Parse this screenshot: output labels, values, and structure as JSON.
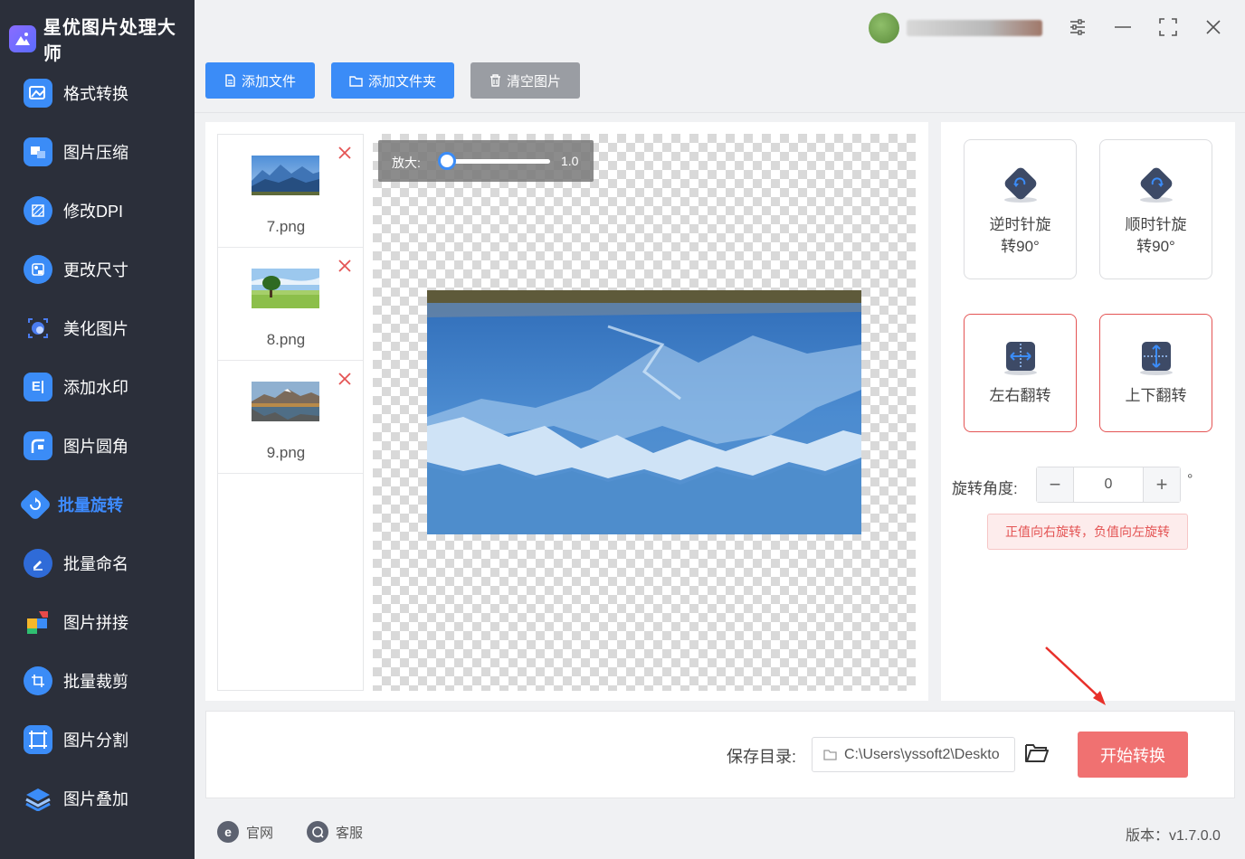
{
  "app": {
    "title": "星优图片处理大师"
  },
  "sidebar": {
    "items": [
      {
        "label": "格式转换",
        "icon": "image-convert-icon",
        "color": "#3b8cf7"
      },
      {
        "label": "图片压缩",
        "icon": "image-compress-icon",
        "color": "#3b8cf7"
      },
      {
        "label": "修改DPI",
        "icon": "dpi-icon",
        "color": "#3b8cf7"
      },
      {
        "label": "更改尺寸",
        "icon": "resize-icon",
        "color": "#3b8cf7"
      },
      {
        "label": "美化图片",
        "icon": "beautify-icon",
        "color": "#4a7cf0"
      },
      {
        "label": "添加水印",
        "icon": "watermark-icon",
        "color": "#3b8cf7"
      },
      {
        "label": "图片圆角",
        "icon": "round-corner-icon",
        "color": "#3b8cf7"
      },
      {
        "label": "批量旋转",
        "icon": "batch-rotate-icon",
        "color": "#3b8cf7",
        "active": true
      },
      {
        "label": "批量命名",
        "icon": "batch-rename-icon",
        "color": "#2f6bd8"
      },
      {
        "label": "图片拼接",
        "icon": "image-stitch-icon",
        "color": "#e84a4a"
      },
      {
        "label": "批量裁剪",
        "icon": "batch-crop-icon",
        "color": "#3b8cf7"
      },
      {
        "label": "图片分割",
        "icon": "image-split-icon",
        "color": "#3b8cf7"
      },
      {
        "label": "图片叠加",
        "icon": "image-layer-icon",
        "color": "#3b8cf7"
      }
    ]
  },
  "toolbar": {
    "add_file": "添加文件",
    "add_folder": "添加文件夹",
    "clear": "清空图片"
  },
  "files": [
    {
      "name": "7.png"
    },
    {
      "name": "8.png"
    },
    {
      "name": "9.png"
    }
  ],
  "preview": {
    "zoom_label": "放大:",
    "zoom_value": "1.0",
    "zoom_level": 0.0
  },
  "operations": {
    "ccw": "逆时针旋转90°",
    "cw": "顺时针旋转90°",
    "flip_h": "左右翻转",
    "flip_v": "上下翻转"
  },
  "rotation": {
    "label": "旋转角度:",
    "value": "0",
    "unit": "°",
    "hint": "正值向右旋转，负值向左旋转"
  },
  "save": {
    "label": "保存目录:",
    "path": "C:\\Users\\yssoft2\\Deskto"
  },
  "start_button": "开始转换",
  "footer": {
    "website": "官网",
    "support": "客服",
    "version": "版本：v1.7.0.0"
  },
  "colors": {
    "sidebar_bg": "#2b2f3a",
    "accent": "#3b8cf7",
    "start": "#f07171",
    "danger": "#e45454"
  }
}
